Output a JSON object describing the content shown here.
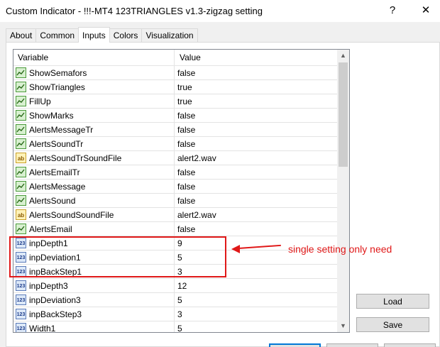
{
  "window": {
    "title": "Custom Indicator - !!!-MT4 123TRIANGLES v1.3-zigzag setting",
    "help_label": "?",
    "close_label": "✕"
  },
  "tabs": [
    {
      "label": "About"
    },
    {
      "label": "Common"
    },
    {
      "label": "Inputs"
    },
    {
      "label": "Colors"
    },
    {
      "label": "Visualization"
    }
  ],
  "active_tab": "Inputs",
  "grid": {
    "col_variable": "Variable",
    "col_value": "Value",
    "rows": [
      {
        "type": "bool",
        "name": "ShowSemafors",
        "value": "false"
      },
      {
        "type": "bool",
        "name": "ShowTriangles",
        "value": "true"
      },
      {
        "type": "bool",
        "name": "FillUp",
        "value": "true"
      },
      {
        "type": "bool",
        "name": "ShowMarks",
        "value": "false"
      },
      {
        "type": "bool",
        "name": "AlertsMessageTr",
        "value": "false"
      },
      {
        "type": "bool",
        "name": "AlertsSoundTr",
        "value": "false"
      },
      {
        "type": "str",
        "name": "AlertsSoundTrSoundFile",
        "value": "alert2.wav"
      },
      {
        "type": "bool",
        "name": "AlertsEmailTr",
        "value": "false"
      },
      {
        "type": "bool",
        "name": "AlertsMessage",
        "value": "false"
      },
      {
        "type": "bool",
        "name": "AlertsSound",
        "value": "false"
      },
      {
        "type": "str",
        "name": "AlertsSoundSoundFile",
        "value": "alert2.wav"
      },
      {
        "type": "bool",
        "name": "AlertsEmail",
        "value": "false"
      },
      {
        "type": "num",
        "name": "inpDepth1",
        "value": "9"
      },
      {
        "type": "num",
        "name": "inpDeviation1",
        "value": "5"
      },
      {
        "type": "num",
        "name": "inpBackStep1",
        "value": "3"
      },
      {
        "type": "num",
        "name": "inpDepth3",
        "value": "12"
      },
      {
        "type": "num",
        "name": "inpDeviation3",
        "value": "5"
      },
      {
        "type": "num",
        "name": "inpBackStep3",
        "value": "3"
      },
      {
        "type": "num",
        "name": "Width1",
        "value": "5"
      }
    ]
  },
  "icons": {
    "bool": "bool-param-icon",
    "str": "string-param-icon",
    "num": "integer-param-icon",
    "num_text": "123",
    "str_text": "ab"
  },
  "buttons": {
    "load": "Load",
    "save": "Save"
  },
  "annotation": {
    "note": "single setting only need",
    "color": "#e01818"
  }
}
